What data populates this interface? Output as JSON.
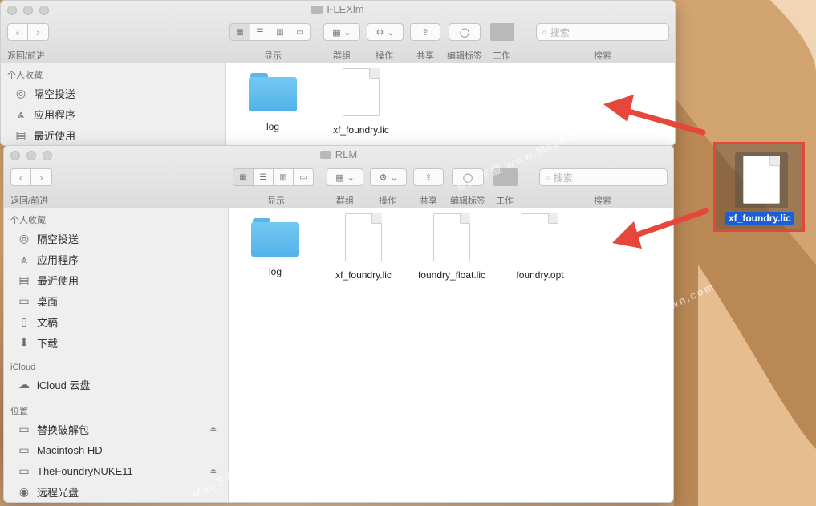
{
  "watermark": "Mac下载 www.Macdown.com",
  "toolbar_labels": {
    "nav": "返回/前进",
    "view": "显示",
    "group": "群组",
    "action": "操作",
    "share": "共享",
    "tags": "编辑标签",
    "work": "工作",
    "search": "搜索"
  },
  "search_placeholder": "搜索",
  "sidebar": {
    "favorites_header": "个人收藏",
    "favorites": [
      {
        "label": "隔空投送",
        "icon": "airdrop-icon"
      },
      {
        "label": "应用程序",
        "icon": "applications-icon"
      },
      {
        "label": "最近使用",
        "icon": "recents-icon"
      },
      {
        "label": "桌面",
        "icon": "desktop-icon"
      },
      {
        "label": "文稿",
        "icon": "documents-icon"
      },
      {
        "label": "下载",
        "icon": "downloads-icon"
      }
    ],
    "icloud_header": "iCloud",
    "icloud": [
      {
        "label": "iCloud 云盘",
        "icon": "icloud-icon"
      }
    ],
    "locations_header": "位置",
    "locations": [
      {
        "label": "替换破解包",
        "icon": "disk-icon",
        "eject": true
      },
      {
        "label": "Macintosh HD",
        "icon": "disk-icon",
        "eject": false
      },
      {
        "label": "TheFoundryNUKE11",
        "icon": "disk-icon",
        "eject": true
      },
      {
        "label": "远程光盘",
        "icon": "optical-disc-icon",
        "eject": false
      }
    ]
  },
  "window_back": {
    "title": "FLEXlm",
    "files": [
      {
        "name": "log",
        "kind": "folder"
      },
      {
        "name": "xf_foundry.lic",
        "kind": "document"
      }
    ]
  },
  "window_front": {
    "title": "RLM",
    "files": [
      {
        "name": "log",
        "kind": "folder"
      },
      {
        "name": "xf_foundry.lic",
        "kind": "document"
      },
      {
        "name": "foundry_float.lic",
        "kind": "document"
      },
      {
        "name": "foundry.opt",
        "kind": "document"
      }
    ]
  },
  "desktop_file": {
    "name": "xf_foundry.lic",
    "selected": true
  },
  "colors": {
    "annotation_red": "#e6473a",
    "selection_blue": "#1b5ed8",
    "folder_blue": "#5ab8ec"
  }
}
